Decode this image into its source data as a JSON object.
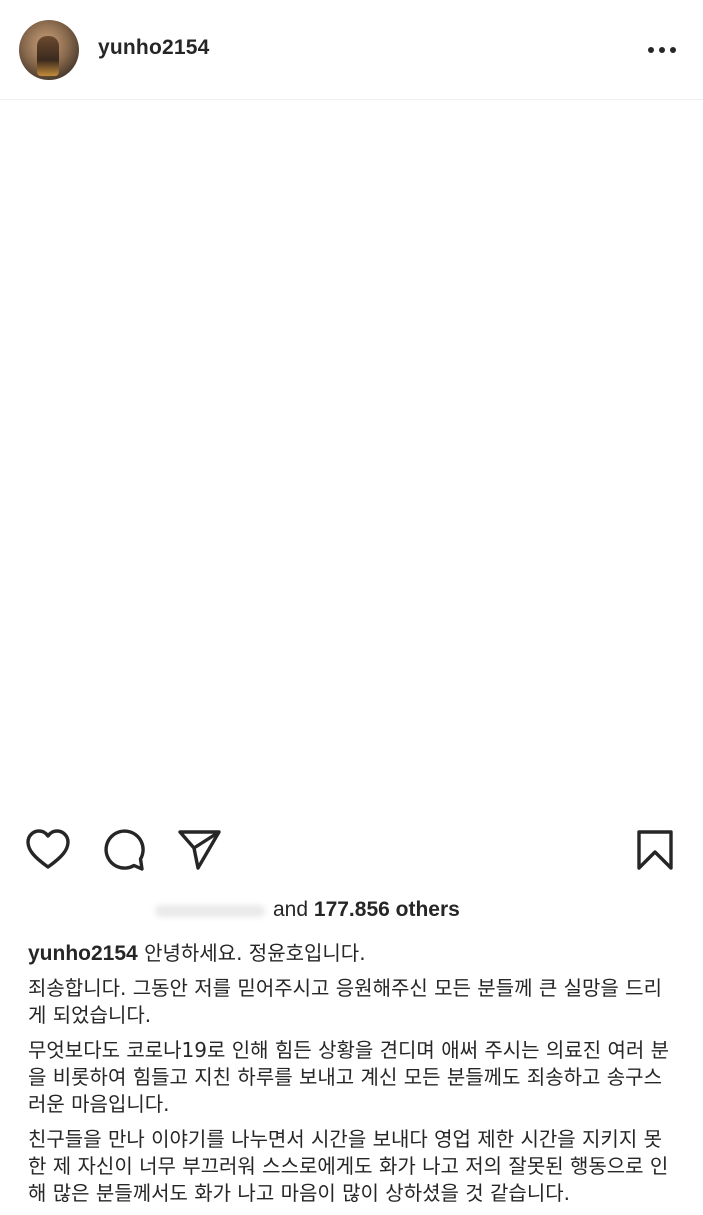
{
  "header": {
    "username": "yunho2154"
  },
  "actions": {
    "like_icon": "heart-icon",
    "comment_icon": "comment-icon",
    "share_icon": "paper-plane-icon",
    "save_icon": "bookmark-icon"
  },
  "likes": {
    "connector": "and",
    "count": "177.856",
    "suffix": "others"
  },
  "caption": {
    "username": "yunho2154",
    "first_line": "안녕하세요. 정윤호입니다.",
    "paragraphs": [
      "죄송합니다. 그동안 저를 믿어주시고 응원해주신 모든 분들께 큰 실망을 드리게 되었습니다.",
      "무엇보다도 코로나19로 인해 힘든 상황을 견디며 애써 주시는 의료진 여러 분을 비롯하여 힘들고 지친 하루를 보내고 계신 모든 분들께도 죄송하고 송구스러운 마음입니다.",
      "친구들을 만나 이야기를 나누면서 시간을 보내다 영업 제한 시간을 지키지 못한 제 자신이 너무 부끄러워 스스로에게도 화가 나고 저의 잘못된 행동으로 인해 많은 분들께서도 화가 나고 마음이 많이 상하셨을 것 같습니다."
    ]
  },
  "colors": {
    "text": "#262626",
    "divider": "#efefef",
    "background": "#ffffff"
  }
}
